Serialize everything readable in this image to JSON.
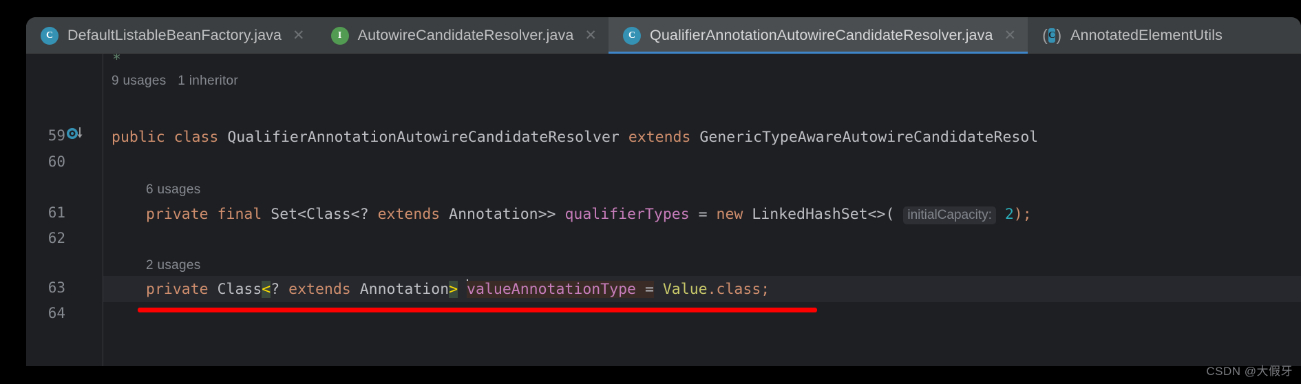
{
  "window": {
    "background": "#1E1F22",
    "tabbar_background": "#3C3F41",
    "active_tab_background": "#4B4E50",
    "active_tab_underline": "#3E86C9"
  },
  "tabs": [
    {
      "label": "DefaultListableBeanFactory.java",
      "icon": "class-icon",
      "icon_letter": "C",
      "icon_kind": "class",
      "active": false,
      "closable": true,
      "close_label": "✕"
    },
    {
      "label": "AutowireCandidateResolver.java",
      "icon": "interface-icon",
      "icon_letter": "I",
      "icon_kind": "interface",
      "active": false,
      "closable": true,
      "close_label": "✕"
    },
    {
      "label": "QualifierAnnotationAutowireCandidateResolver.java",
      "icon": "class-icon",
      "icon_letter": "C",
      "icon_kind": "class",
      "active": true,
      "closable": true,
      "close_label": "✕"
    },
    {
      "label": "AnnotatedElementUtils",
      "icon": "library-class-icon",
      "icon_letter": "C",
      "icon_kind": "library",
      "active": false,
      "closable": false,
      "close_label": ""
    }
  ],
  "gutter": {
    "line_numbers": [
      "59",
      "60",
      "61",
      "62",
      "63",
      "64"
    ],
    "marker_name": "implemented-method-marker"
  },
  "code_hints": [
    {
      "text": "9 usages   1 inheritor",
      "line_ref": "59"
    },
    {
      "text": "6 usages",
      "line_ref": "61"
    },
    {
      "text": "2 usages",
      "line_ref": "63"
    }
  ],
  "code": {
    "line59": {
      "keyword1": "public",
      "keyword2": "class",
      "class_name": "QualifierAnnotationAutowireCandidateResolver",
      "keyword3": "extends",
      "super_name": "GenericTypeAwareAutowireCandidateResol"
    },
    "line61": {
      "modifier1": "private",
      "modifier2": "final",
      "type_part1": "Set<Class<? ",
      "kw_extends": "extends",
      "type_part2": " Annotation>>",
      "field_name": "qualifierTypes",
      "assign": "=",
      "kw_new": "new",
      "ctor": "LinkedHashSet<>(",
      "param_hint": "initialCapacity:",
      "number": "2",
      "tail": ");"
    },
    "line63": {
      "modifier": "private",
      "type_name": "Class",
      "angle_open": "<",
      "wildcard": "? ",
      "kw_extends": "extends",
      "inner_type": " Annotation",
      "angle_close": ">",
      "field_name": "valueAnnotationType",
      "assign": "=",
      "value_class": "Value",
      "dot_class": ".class",
      "semicolon": ";"
    }
  },
  "annotation": {
    "red_line_color": "#FF0000"
  },
  "watermark": {
    "text": "CSDN @大假牙"
  },
  "colors": {
    "keyword": "#CF8E6D",
    "type": "#BCBEC4",
    "field": "#C77DBB",
    "number": "#2AACB8",
    "class_literal": "#C9C96A",
    "comment": "#5F826B",
    "hint": "#868A91",
    "brace_match_bg": "#3A4A3C",
    "brace_match_fg": "#FFE000",
    "identifier_hl_bg": "#3A2B26",
    "caret_line_bg": "#26282E"
  }
}
